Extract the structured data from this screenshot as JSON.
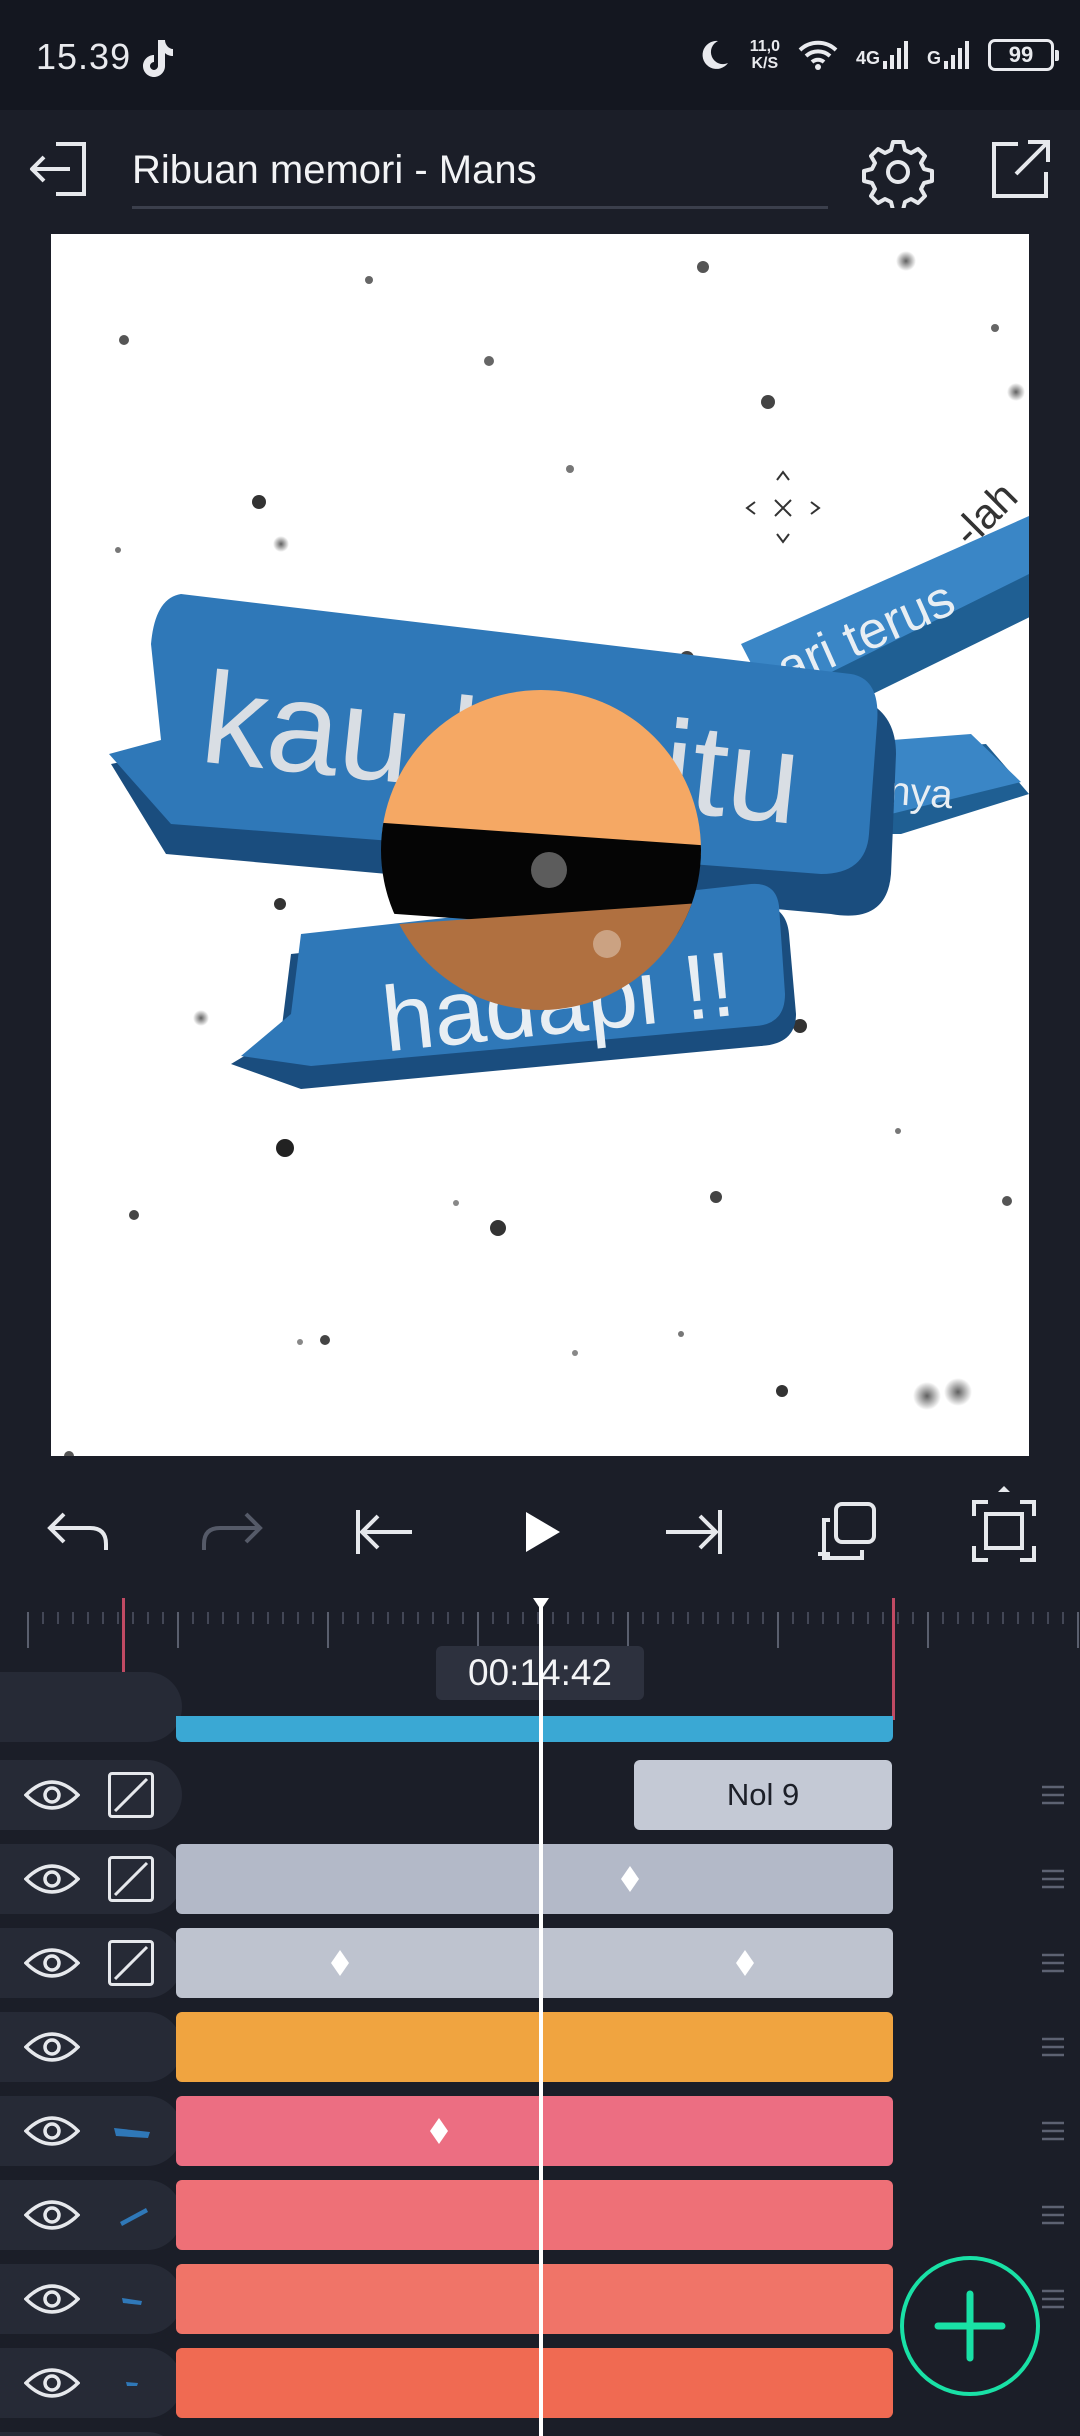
{
  "status_bar": {
    "time": "15.39",
    "net_speed_value": "11,0",
    "net_speed_unit": "K/S",
    "net_4g": "4G",
    "net_g": "G",
    "battery": "99"
  },
  "header": {
    "title": "Ribuan memori - Mans"
  },
  "canvas": {
    "bubble_main": "kau begitu",
    "bubble_bottom": "hadapi !!",
    "bubble_top_right": "ari terus",
    "bubble_middle_right": "pinya",
    "text_corner": "-lah"
  },
  "timeline": {
    "timecode": "00:14:42",
    "clip_label": "Nol 9"
  },
  "colors": {
    "accent": "#19e1a6",
    "layer_blue": "#3aa8d4",
    "layer_grey": "#b6bcca",
    "layer_orange": "#f0a440",
    "layer_pink": "#ec6e82",
    "layer_salmon": "#f07468",
    "layer_coral": "#f06a52",
    "marker": "#c04a63"
  }
}
